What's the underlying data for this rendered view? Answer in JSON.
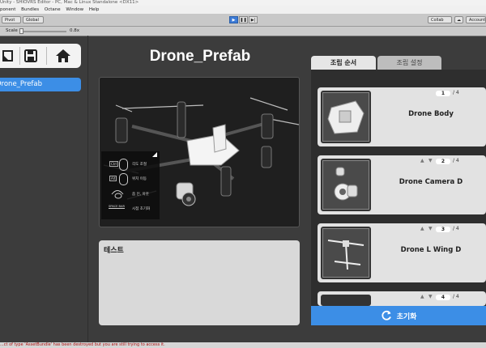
{
  "window": {
    "title": "Unity - SHIOVRS Editor - PC, Mac & Linux Standalone <DX11>"
  },
  "menubar": {
    "items": [
      "ponent",
      "Bundles",
      "Octane",
      "Window",
      "Help"
    ]
  },
  "toolbar": {
    "pivot_label": "Pivot",
    "global_label": "Global",
    "collab_label": "Collab",
    "account_label": "Account"
  },
  "gamebar": {
    "scale_label": "Scale",
    "scale_value": "0.8x"
  },
  "left_panel": {
    "tools": [
      "folder-icon",
      "save-icon",
      "home-icon"
    ],
    "selected_item": "Drone_Prefab"
  },
  "main": {
    "title": "Drone_Prefab",
    "controls": [
      {
        "key": "Ctrl",
        "label": "각도 조절"
      },
      {
        "key": "Alt",
        "label": "위치 이동"
      },
      {
        "key": "",
        "label": "줌 인, 아웃"
      },
      {
        "key": "SPACE BAR",
        "label": "시점 초기화"
      }
    ],
    "memo_title": "테스트"
  },
  "right_panel": {
    "tabs": [
      "조립 순서",
      "조립 설정"
    ],
    "active_tab": "조립 순서",
    "items": [
      {
        "order": "1",
        "total": "/ 4",
        "name": "Drone Body"
      },
      {
        "order": "2",
        "total": "/ 4",
        "name": "Drone Camera D"
      },
      {
        "order": "3",
        "total": "/ 4",
        "name": "Drone L Wing D"
      },
      {
        "order": "4",
        "total": "/ 4",
        "name": ""
      }
    ],
    "reset_label": "초기화"
  },
  "status": {
    "message": "...ct of type 'AssetBundle' has been destroyed but you are still trying to access it."
  },
  "colors": {
    "accent": "#3c8ee6",
    "panel_dark": "#3c3c3c",
    "card": "#e2e2e2"
  }
}
